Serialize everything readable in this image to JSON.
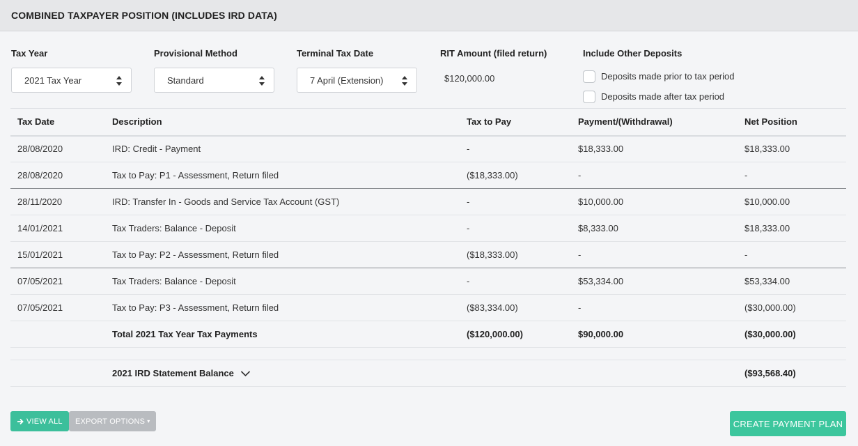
{
  "header": {
    "title": "COMBINED TAXPAYER POSITION (INCLUDES IRD DATA)"
  },
  "filters": {
    "tax_year": {
      "label": "Tax Year",
      "value": "2021 Tax Year"
    },
    "provisional_method": {
      "label": "Provisional Method",
      "value": "Standard"
    },
    "terminal_tax_date": {
      "label": "Terminal Tax Date",
      "value": "7 April (Extension)"
    },
    "rit_amount": {
      "label": "RIT Amount (filed return)",
      "value": "$120,000.00"
    },
    "other_deposits": {
      "label": "Include Other Deposits",
      "options": [
        "Deposits made prior to tax period",
        "Deposits made after tax period"
      ]
    }
  },
  "table": {
    "columns": [
      "Tax Date",
      "Description",
      "Tax to Pay",
      "Payment/(Withdrawal)",
      "Net Position"
    ],
    "rows": [
      {
        "date": "28/08/2020",
        "desc": "IRD: Credit - Payment",
        "tax": "-",
        "pay": "$18,333.00",
        "net": "$18,333.00"
      },
      {
        "date": "28/08/2020",
        "desc": "Tax to Pay: P1 - Assessment, Return filed",
        "tax": "($18,333.00)",
        "pay": "-",
        "net": "-"
      },
      {
        "date": "28/11/2020",
        "desc": "IRD: Transfer In - Goods and Service Tax Account (GST)",
        "tax": "-",
        "pay": "$10,000.00",
        "net": "$10,000.00"
      },
      {
        "date": "14/01/2021",
        "desc": "Tax Traders: Balance - Deposit",
        "tax": "-",
        "pay": "$8,333.00",
        "net": "$18,333.00"
      },
      {
        "date": "15/01/2021",
        "desc": "Tax to Pay: P2 - Assessment, Return filed",
        "tax": "($18,333.00)",
        "pay": "-",
        "net": "-"
      },
      {
        "date": "07/05/2021",
        "desc": "Tax Traders: Balance - Deposit",
        "tax": "-",
        "pay": "$53,334.00",
        "net": "$53,334.00"
      },
      {
        "date": "07/05/2021",
        "desc": "Tax to Pay: P3 - Assessment, Return filed",
        "tax": "($83,334.00)",
        "pay": "-",
        "net": "($30,000.00)"
      }
    ],
    "total": {
      "label": "Total 2021 Tax Year Tax Payments",
      "tax": "($120,000.00)",
      "pay": "$90,000.00",
      "net": "($30,000.00)"
    },
    "balance": {
      "label": "2021 IRD Statement Balance",
      "net": "($93,568.40)"
    }
  },
  "actions": {
    "view_all": "VIEW ALL",
    "export_options": "EXPORT OPTIONS",
    "create_payment_plan": "CREATE PAYMENT PLAN"
  },
  "colors": {
    "accent_green": "#3cc69d",
    "export_grey": "#b9bcc0"
  }
}
